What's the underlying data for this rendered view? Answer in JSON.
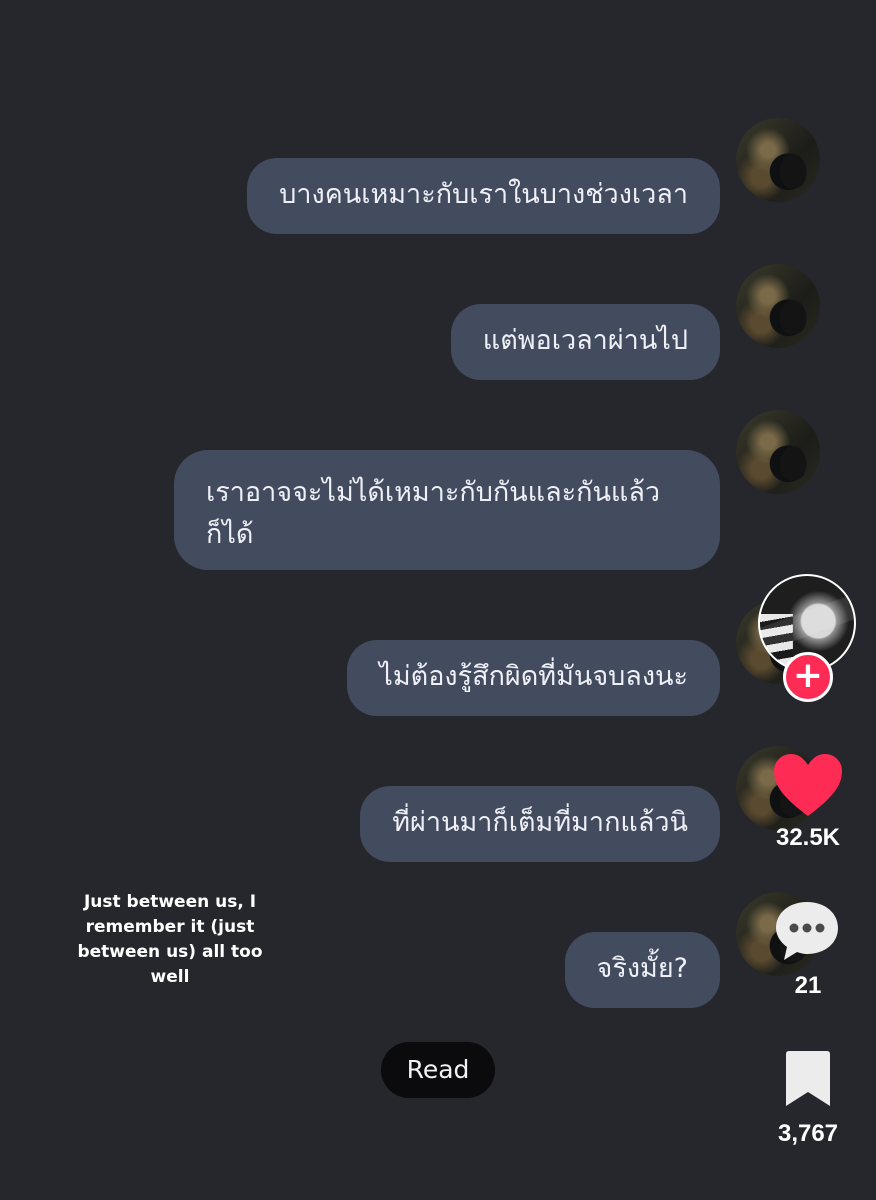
{
  "messages": [
    {
      "text": "บางคนเหมาะกับเราในบางช่วงเวลา"
    },
    {
      "text": "แต่พอเวลาผ่านไป"
    },
    {
      "text": "เราอาจจะไม่ได้เหมาะกับกันและกันแล้ว ก็ได้"
    },
    {
      "text": "ไม่ต้องรู้สึกผิดที่มันจบลงนะ"
    },
    {
      "text": "ที่ผ่านมาก็เต็มที่มากแล้วนิ"
    },
    {
      "text": "จริงมั้ย?"
    }
  ],
  "read_label": "Read",
  "caption": "Just between us, I remember it (just between us) all too well",
  "sidebar": {
    "likes": "32.5K",
    "comments": "21",
    "saves": "3,767",
    "icons": [
      "creator-avatar",
      "follow-plus-icon",
      "heart-icon",
      "comment-bubble-icon",
      "bookmark-icon"
    ]
  },
  "colors": {
    "background": "#26262d",
    "bubble": "#434b5f",
    "like": "#fe2c55"
  }
}
